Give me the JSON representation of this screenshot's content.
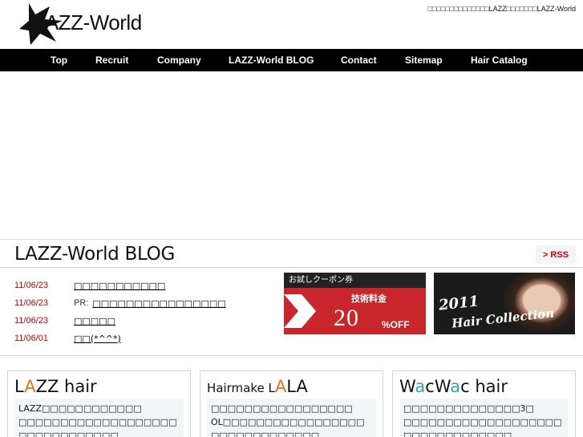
{
  "header": {
    "logo_text": "LAZZ-World",
    "tagline": "□□□□□□□□□□□□□□LAZZ□□□□□□□LAZZ-World"
  },
  "nav": {
    "items": [
      "Top",
      "Recruit",
      "Company",
      "LAZZ-World BLOG",
      "Contact",
      "Sitemap",
      "Hair Catalog"
    ]
  },
  "blog": {
    "title": "LAZZ-World BLOG",
    "rss_label": "> RSS",
    "posts": [
      {
        "date": "11/06/23",
        "pr": "",
        "title": "□□□□□□□□□□□"
      },
      {
        "date": "11/06/23",
        "pr": "PR:",
        "title": "□□□□□□□□□□□□□□□□"
      },
      {
        "date": "11/06/23",
        "pr": "",
        "title": "□□□□□"
      },
      {
        "date": "11/06/01",
        "pr": "",
        "title": "□□(*^^*)"
      }
    ],
    "coupon_banner": {
      "top_text": "お試しクーポン券",
      "tech_text": "技術料金",
      "percent": "20",
      "off_text": "%OFF"
    },
    "collection_banner": {
      "year": "2011",
      "text": "Hair Collection"
    }
  },
  "salons": [
    {
      "logo_prefix": "L",
      "logo_accent": "A",
      "logo_rest": "ZZ hair",
      "line1": "LAZZ□□□□□□□□□□□□",
      "line2": "□□□□□□□□□□□□□□□□□□□□□□□□□□□□□□□"
    },
    {
      "logo_prefix": "Hairmake L",
      "logo_accent": "A",
      "logo_rest": "LA",
      "line1": "□□□□□□□□□□□□□□□□□",
      "line2": "OL□□□□□□□□□□□□□□□□□□□□□□□□□□□□□□"
    },
    {
      "logo_prefix": "W",
      "logo_accent": "a",
      "logo_rest": "cW",
      "logo_accent2": "a",
      "logo_rest2": "c hair",
      "line1": "□□□□□□□□□□□□□□3□",
      "line2": "□□□□□□□□□□□□□□□□□□□□□□□□□□□□□□□□"
    }
  ],
  "colors": {
    "accent_red": "#cc0000",
    "nav_bg": "#000000",
    "logo_orange": "#e8731a",
    "logo_teal": "#2fa7a8"
  }
}
